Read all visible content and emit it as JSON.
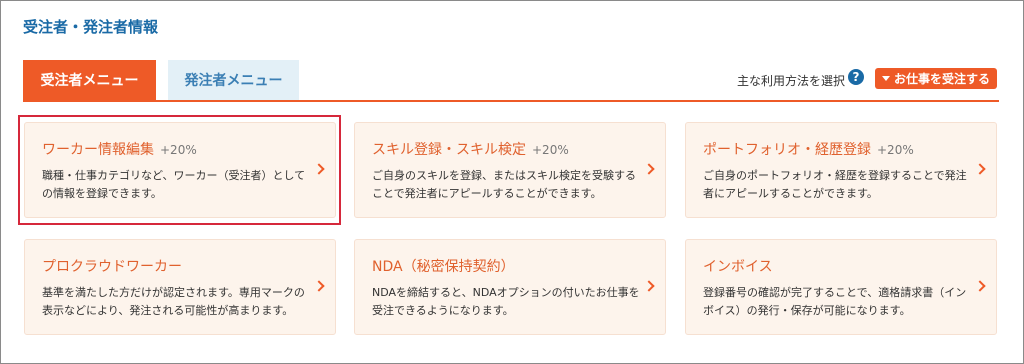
{
  "section_title": "受注者・発注者情報",
  "tabs": [
    {
      "label": "受注者メニュー",
      "active": true
    },
    {
      "label": "発注者メニュー",
      "active": false
    }
  ],
  "usage_label": "主な利用方法を選択",
  "help_icon": "?",
  "orders_button_label": "お仕事を受注する",
  "colors": {
    "accent": "#ee5a27",
    "link_blue": "#1a6aa6",
    "card_bg": "#fdf4ec",
    "highlight": "#d6283b"
  },
  "cards": [
    {
      "title": "ワーカー情報編集",
      "bonus": "+20%",
      "desc": "職種・仕事カテゴリなど、ワーカー（受注者）としての情報を登録できます。"
    },
    {
      "title": "スキル登録・スキル検定",
      "bonus": "+20%",
      "desc": "ご自身のスキルを登録、またはスキル検定を受験することで発注者にアピールすることができます。"
    },
    {
      "title": "ポートフォリオ・経歴登録",
      "bonus": "+20%",
      "desc": "ご自身のポートフォリオ・経歴を登録することで発注者にアピールすることができます。"
    },
    {
      "title": "プロクラウドワーカー",
      "bonus": "",
      "desc": "基準を満たした方だけが認定されます。専用マークの表示などにより、発注される可能性が高まります。"
    },
    {
      "title": "NDA（秘密保持契約）",
      "bonus": "",
      "desc": "NDAを締結すると、NDAオプションの付いたお仕事を受注できるようになります。"
    },
    {
      "title": "インボイス",
      "bonus": "",
      "desc": "登録番号の確認が完了することで、適格請求書（インボイス）の発行・保存が可能になります。"
    }
  ]
}
